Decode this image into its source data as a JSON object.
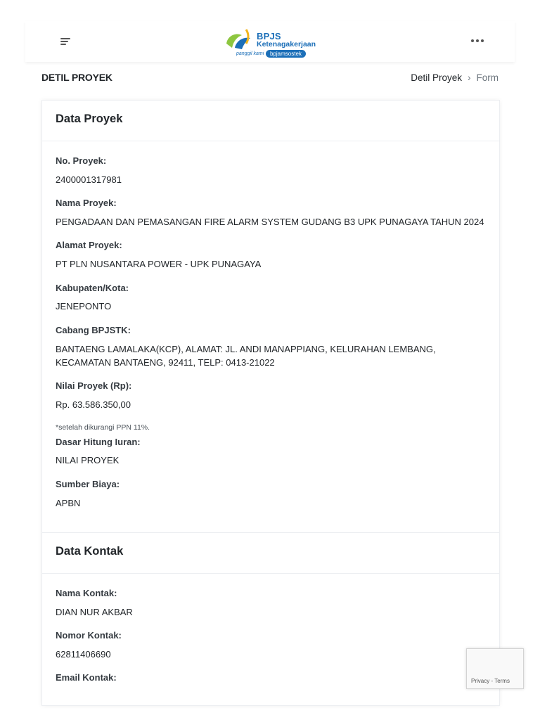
{
  "header": {
    "menu_icon": "hamburger-icon",
    "logo": {
      "brand": "BPJS",
      "sub": "Ketenagakerjaan",
      "tagline_prefix": "panggil kami",
      "tagline_pill": "bpjamsostek"
    },
    "more_icon": "more-horizontal-icon"
  },
  "page": {
    "title": "DETIL PROYEK",
    "breadcrumb": {
      "item1": "Detil Proyek",
      "separator": "›",
      "current": "Form"
    }
  },
  "data_proyek": {
    "title": "Data Proyek",
    "fields": [
      {
        "label": "No. Proyek:",
        "value": "2400001317981"
      },
      {
        "label": "Nama Proyek:",
        "value": "PENGADAAN DAN PEMASANGAN FIRE ALARM SYSTEM GUDANG B3 UPK PUNAGAYA TAHUN 2024"
      },
      {
        "label": "Alamat Proyek:",
        "value": "PT PLN NUSANTARA POWER - UPK PUNAGAYA"
      },
      {
        "label": "Kabupaten/Kota:",
        "value": "JENEPONTO"
      },
      {
        "label": "Cabang BPJSTK:",
        "value": "BANTAENG LAMALAKA(KCP), ALAMAT: JL. ANDI MANAPPIANG, KELURAHAN LEMBANG, KECAMATAN BANTAENG, 92411, TELP: 0413-21022"
      },
      {
        "label": "Nilai Proyek (Rp):",
        "value": "Rp. 63.586.350,00",
        "note": "*setelah dikurangi PPN 11%."
      },
      {
        "label": "Dasar Hitung Iuran:",
        "value": "NILAI PROYEK"
      },
      {
        "label": "Sumber Biaya:",
        "value": "APBN"
      }
    ]
  },
  "data_kontak": {
    "title": "Data Kontak",
    "fields": [
      {
        "label": "Nama Kontak:",
        "value": "DIAN NUR AKBAR"
      },
      {
        "label": "Nomor Kontak:",
        "value": "62811406690"
      },
      {
        "label": "Email Kontak:",
        "value": ""
      }
    ]
  },
  "recaptcha": {
    "links": "Privacy - Terms"
  },
  "colors": {
    "brand_blue": "#1c6fb8",
    "brand_green": "#8dc63f",
    "text": "#212529",
    "muted": "#6c757d"
  }
}
